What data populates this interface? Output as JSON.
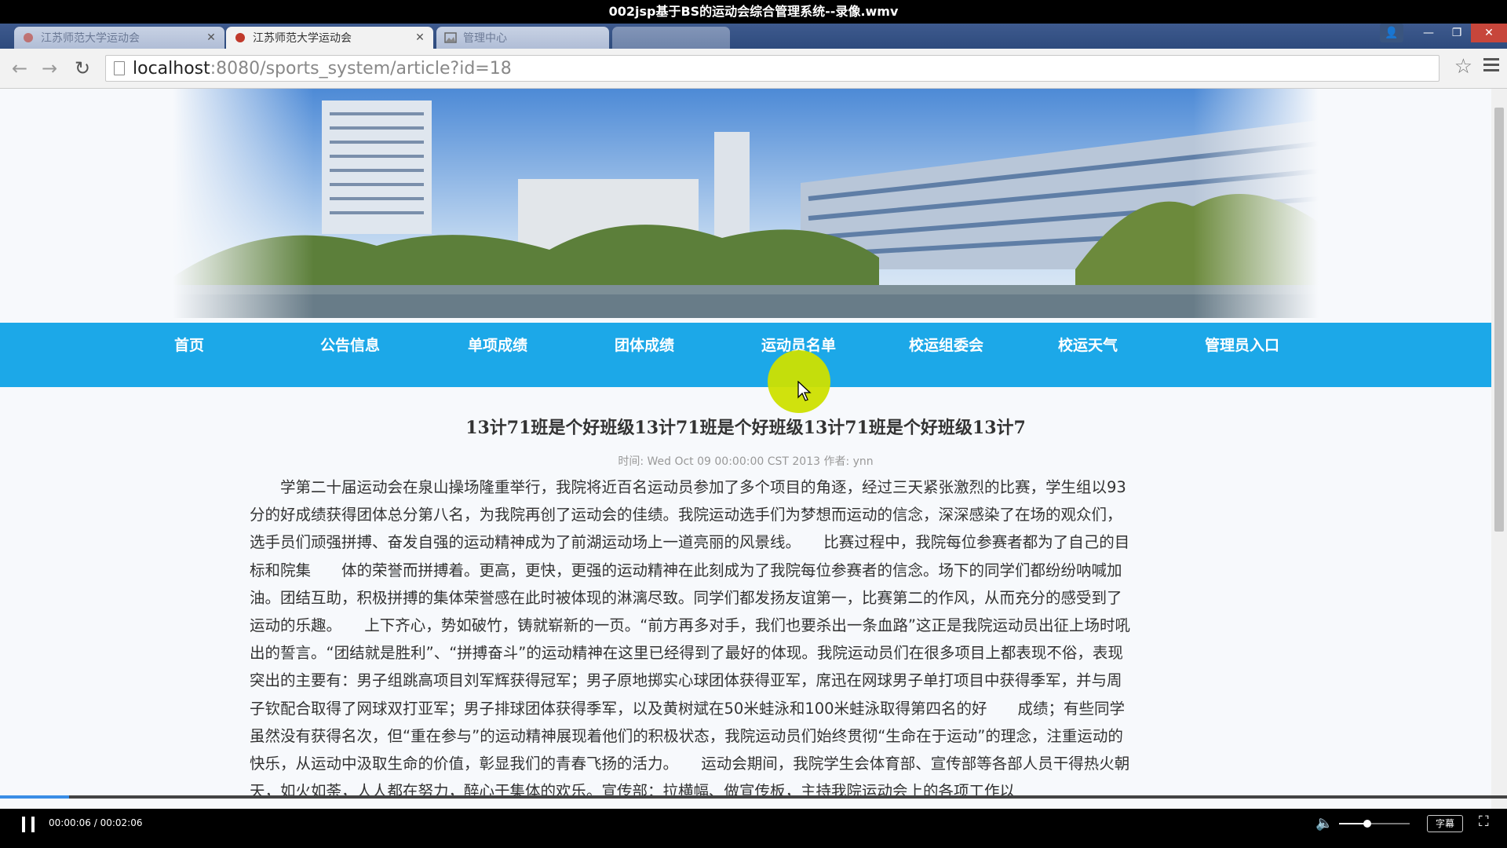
{
  "player": {
    "title": "002jsp基于BS的运动会综合管理系统--录像.wmv",
    "time": "00:00:06 / 00:02:06",
    "progress_fraction": 0.046,
    "volume_fraction": 0.4,
    "subtitle_label": "字幕"
  },
  "browser": {
    "tabs": [
      {
        "label": "江苏师范大学运动会",
        "active": false
      },
      {
        "label": "江苏师范大学运动会",
        "active": true
      },
      {
        "label": "管理中心",
        "active": false
      }
    ],
    "url_host": "localhost",
    "url_path": ":8080/sports_system/article?id=18"
  },
  "nav": {
    "items": [
      "首页",
      "公告信息",
      "单项成绩",
      "团体成绩",
      "运动员名单",
      "校运组委会",
      "校运天气",
      "管理员入口"
    ]
  },
  "article": {
    "title": "13计71班是个好班级13计71班是个好班级13计71班是个好班级13计7",
    "meta": "时间: Wed Oct 09 00:00:00 CST 2013 作者: ynn",
    "body": "学第二十届运动会在泉山操场隆重举行，我院将近百名运动员参加了多个项目的角逐，经过三天紧张激烈的比赛，学生组以93分的好成绩获得团体总分第八名，为我院再创了运动会的佳绩。我院运动选手们为梦想而运动的信念，深深感染了在场的观众们，选手员们顽强拼搏、奋发自强的运动精神成为了前湖运动场上一道亮丽的风景线。　　比赛过程中，我院每位参赛者都为了自己的目标和院集　　体的荣誉而拼搏着。更高，更快，更强的运动精神在此刻成为了我院每位参赛者的信念。场下的同学们都纷纷呐喊加油。团结互助，积极拼搏的集体荣誉感在此时被体现的淋漓尽致。同学们都发扬友谊第一，比赛第二的作风，从而充分的感受到了运动的乐趣。　　上下齐心，势如破竹，铸就崭新的一页。“前方再多对手，我们也要杀出一条血路”这正是我院运动员出征上场时吼出的誓言。“团结就是胜利”、“拼搏奋斗”的运动精神在这里已经得到了最好的体现。我院运动员们在很多项目上都表现不俗，表现突出的主要有：男子组跳高项目刘军辉获得冠军；男子原地掷实心球团体获得亚军，席迅在网球男子单打项目中获得季军，并与周子钦配合取得了网球双打亚军；男子排球团体获得季军，以及黄树斌在50米蛙泳和100米蛙泳取得第四名的好　　成绩；有些同学虽然没有获得名次，但“重在参与”的运动精神展现着他们的积极状态，我院运动员们始终贯彻“生命在于运动”的理念，注重运动的快乐，从运动中汲取生命的价值，彰显我们的青春飞扬的活力。　　运动会期间，我院学生会体育部、宣传部等各部人员干得热火朝天，如火如荼，人人都在努力，醉心于集体的欢乐。宣传部：拉横幅、做宣传板，主持我院运动会上的各项工作以"
  },
  "colors": {
    "nav_bg": "#1ca8e8",
    "cursor_highlight": "#cde000",
    "tab_strip": "#2e4b7d"
  }
}
